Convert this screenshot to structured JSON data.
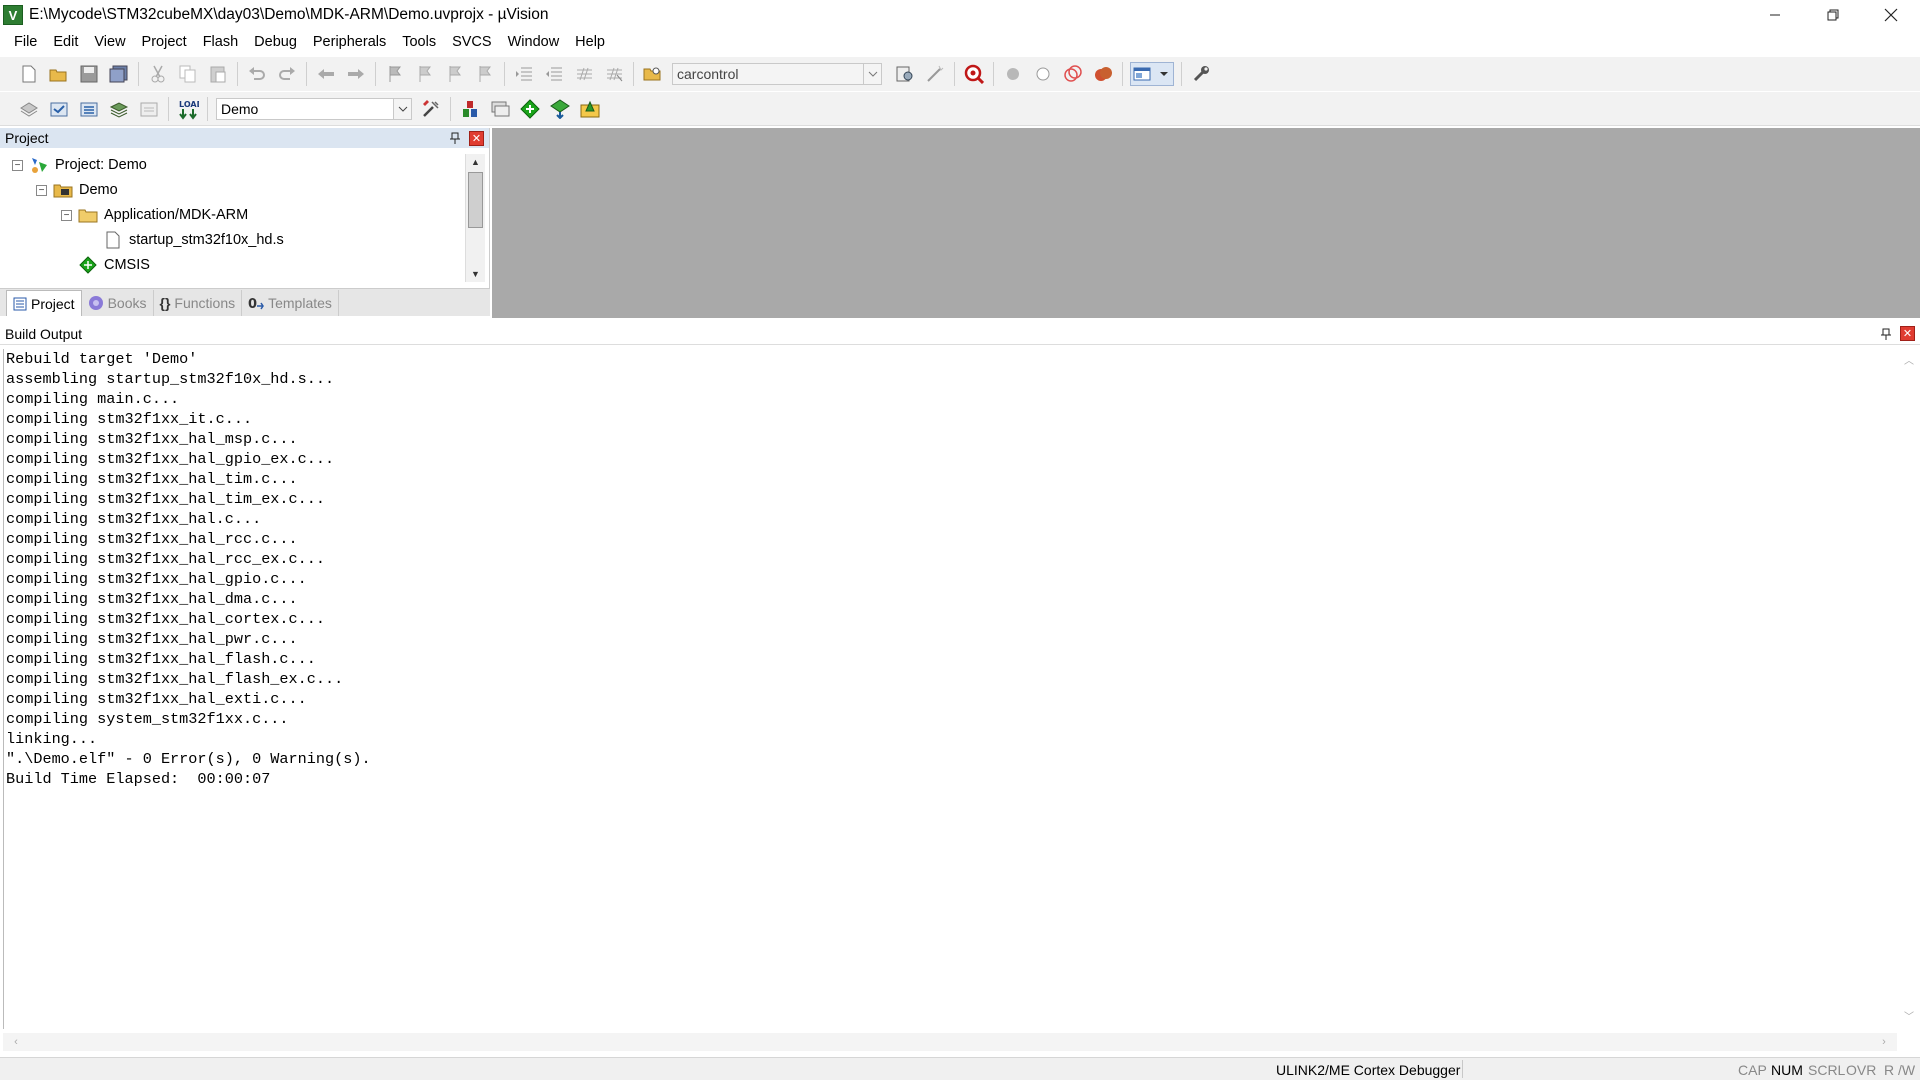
{
  "window": {
    "title": "E:\\Mycode\\STM32cubeMX\\day03\\Demo\\MDK-ARM\\Demo.uvprojx - µVision",
    "app_icon_letter": "V"
  },
  "menu": [
    "File",
    "Edit",
    "View",
    "Project",
    "Flash",
    "Debug",
    "Peripherals",
    "Tools",
    "SVCS",
    "Window",
    "Help"
  ],
  "toolbar": {
    "find_combo_value": "carcontrol",
    "target_combo_value": "Demo"
  },
  "project_panel": {
    "title": "Project",
    "tree": [
      {
        "label": "Project: Demo"
      },
      {
        "label": "Demo"
      },
      {
        "label": "Application/MDK-ARM"
      },
      {
        "label": "startup_stm32f10x_hd.s"
      },
      {
        "label": "CMSIS"
      }
    ],
    "tabs": [
      {
        "label": "Project",
        "active": true
      },
      {
        "label": "Books",
        "active": false
      },
      {
        "label": "Functions",
        "active": false
      },
      {
        "label": "Templates",
        "active": false
      }
    ]
  },
  "build_output": {
    "title": "Build Output",
    "lines": [
      "Rebuild target 'Demo'",
      "assembling startup_stm32f10x_hd.s...",
      "compiling main.c...",
      "compiling stm32f1xx_it.c...",
      "compiling stm32f1xx_hal_msp.c...",
      "compiling stm32f1xx_hal_gpio_ex.c...",
      "compiling stm32f1xx_hal_tim.c...",
      "compiling stm32f1xx_hal_tim_ex.c...",
      "compiling stm32f1xx_hal.c...",
      "compiling stm32f1xx_hal_rcc.c...",
      "compiling stm32f1xx_hal_rcc_ex.c...",
      "compiling stm32f1xx_hal_gpio.c...",
      "compiling stm32f1xx_hal_dma.c...",
      "compiling stm32f1xx_hal_cortex.c...",
      "compiling stm32f1xx_hal_pwr.c...",
      "compiling stm32f1xx_hal_flash.c...",
      "compiling stm32f1xx_hal_flash_ex.c...",
      "compiling stm32f1xx_hal_exti.c...",
      "compiling system_stm32f1xx.c...",
      "linking...",
      "\".\\Demo.elf\" - 0 Error(s), 0 Warning(s).",
      "Build Time Elapsed:  00:00:07"
    ]
  },
  "status": {
    "debugger": "ULINK2/ME Cortex Debugger",
    "indicators": [
      "CAP",
      "NUM",
      "SCRL",
      "OVR",
      "R /W"
    ],
    "active_indicator": "NUM"
  },
  "colors": {
    "editor_bg": "#a9a9a9",
    "panel_header_bg": "#dbe5f1",
    "close_red": "#e03c31",
    "green_diamond": "#1aa31a"
  }
}
